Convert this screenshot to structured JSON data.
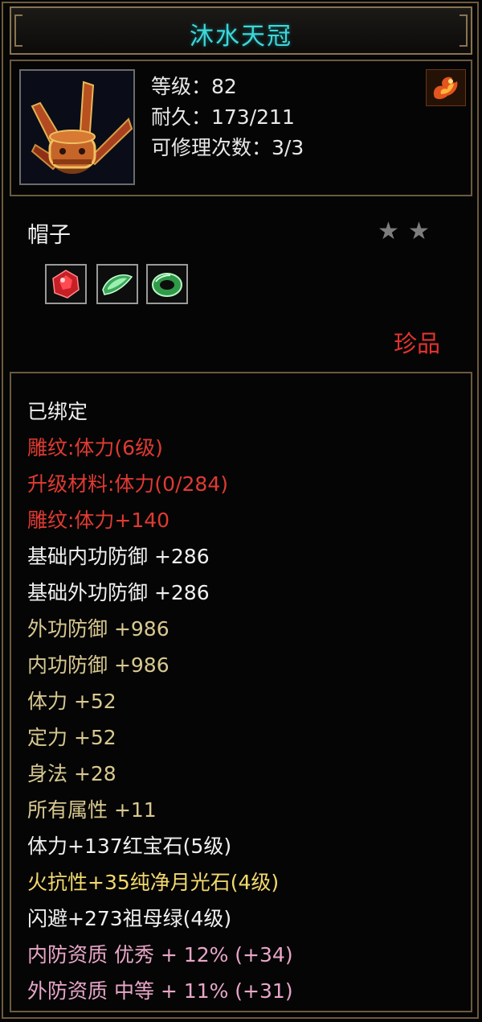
{
  "item": {
    "name": "沐水天冠",
    "level": "等级：82",
    "durability": "耐久：173/211",
    "repairs": "可修理次数：3/3",
    "type": "帽子",
    "stars": 2,
    "rarity": "珍品",
    "item_icon": "crown-icon",
    "badge_icon": "flame-emblem-icon",
    "gems": [
      {
        "icon": "ruby-gem-icon",
        "color": "#d8232a"
      },
      {
        "icon": "moonstone-gem-icon",
        "color": "#5fd07a"
      },
      {
        "icon": "emerald-gem-icon",
        "color": "#4fcf6a"
      }
    ]
  },
  "colors": {
    "title": "#3fd6d8",
    "white": "#f0f0f0",
    "red": "#e03a33",
    "gold": "#d8c890",
    "yellow": "#f2d96c",
    "pink": "#e8a6c8"
  },
  "attributes": [
    {
      "text": "已绑定",
      "color": "#f0f0f0"
    },
    {
      "text": "雕纹:体力(6级)",
      "color": "#e03a33"
    },
    {
      "text": "升级材料:体力(0/284)",
      "color": "#e03a33"
    },
    {
      "text": "雕纹:体力+140",
      "color": "#e03a33"
    },
    {
      "text": "基础内功防御 +286",
      "color": "#f0f0f0"
    },
    {
      "text": "基础外功防御 +286",
      "color": "#f0f0f0"
    },
    {
      "text": "外功防御 +986",
      "color": "#d8c890"
    },
    {
      "text": "内功防御 +986",
      "color": "#d8c890"
    },
    {
      "text": "体力 +52",
      "color": "#d8c890"
    },
    {
      "text": "定力 +52",
      "color": "#d8c890"
    },
    {
      "text": "身法 +28",
      "color": "#d8c890"
    },
    {
      "text": "所有属性 +11",
      "color": "#d8c890"
    },
    {
      "text": "体力+137红宝石(5级)",
      "color": "#f0f0f0"
    },
    {
      "text": "火抗性+35纯净月光石(4级)",
      "color": "#f2d96c"
    },
    {
      "text": "闪避+273祖母绿(4级)",
      "color": "#f0f0f0"
    },
    {
      "text": "内防资质 优秀 + 12% (+34)",
      "color": "#e8a6c8"
    },
    {
      "text": "外防资质 中等 + 11% (+31)",
      "color": "#e8a6c8"
    }
  ]
}
